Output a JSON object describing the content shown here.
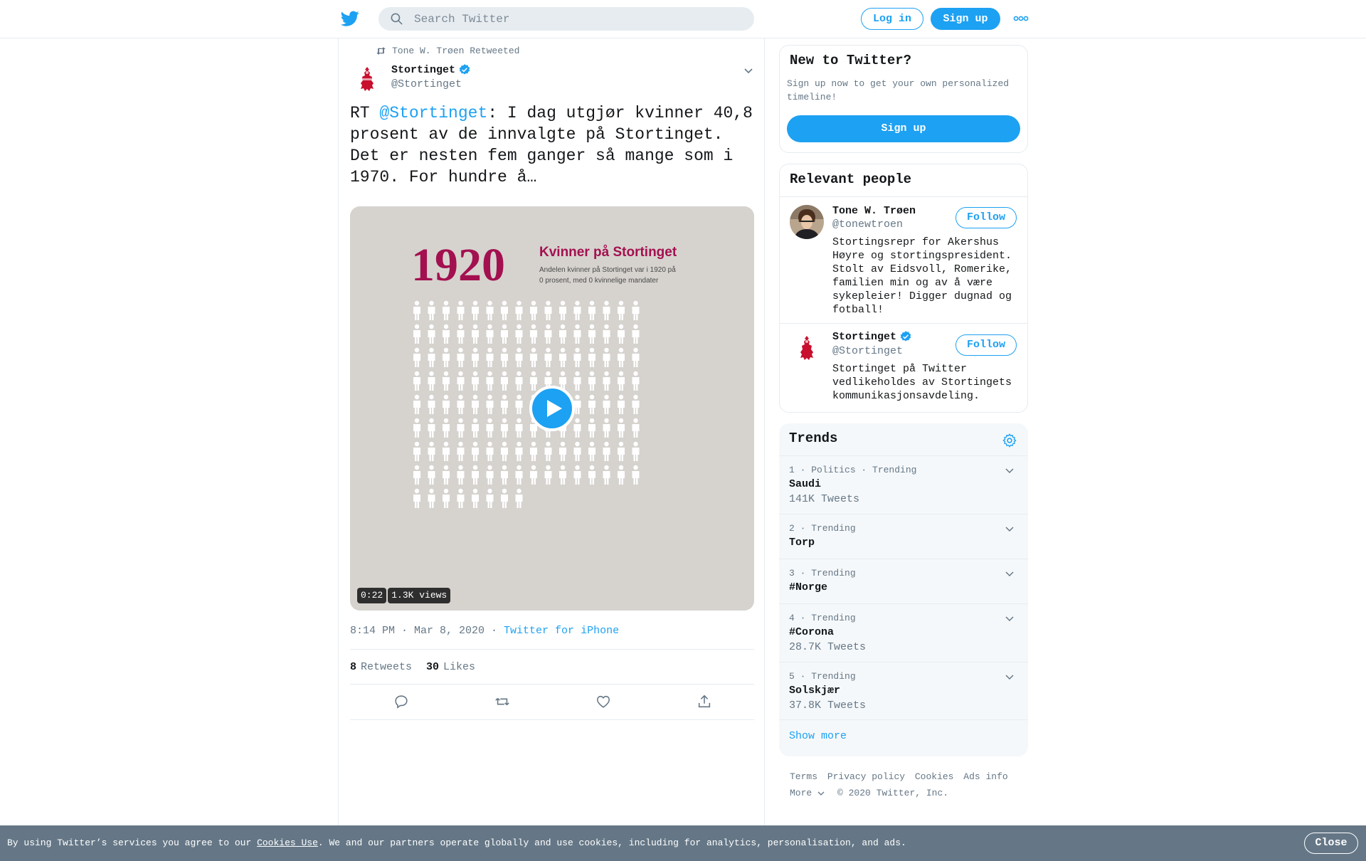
{
  "header": {
    "search_placeholder": "Search Twitter",
    "login_label": "Log in",
    "signup_label": "Sign up"
  },
  "tweet": {
    "retweeted_by": "Tone W. Trøen Retweeted",
    "author_name": "Stortinget",
    "author_handle": "@Stortinget",
    "text_prefix": "RT ",
    "text_mention": "@Stortinget",
    "text_body": ": I dag utgjør kvinner 40,8 prosent av de innvalgte på Stortinget. Det er nesten fem ganger så mange som i 1970. For hundre å…",
    "media": {
      "year": "1920",
      "headline": "Kvinner på Stortinget",
      "caption_line1": "Andelen kvinner på Stortinget var i 1920 på",
      "caption_line2": "0 prosent, med 0 kvinnelige mandater",
      "duration": "0:22",
      "views": "1.3K views"
    },
    "timestamp": "8:14 PM · Mar 8, 2020",
    "separator": " · ",
    "source": "Twitter for iPhone",
    "retweets_count": "8",
    "retweets_label": "Retweets",
    "likes_count": "30",
    "likes_label": "Likes"
  },
  "new_to_twitter": {
    "title": "New to Twitter?",
    "description": "Sign up now to get your own personalized timeline!",
    "signup_label": "Sign up"
  },
  "relevant_people": {
    "title": "Relevant people",
    "people": [
      {
        "name": "Tone W. Trøen",
        "handle": "@tonewtroen",
        "bio": "Stortingsrepr for Akershus Høyre og stortingspresident. Stolt av Eidsvoll, Romerike, familien min og av å være sykepleier! Digger dugnad og fotball!",
        "follow_label": "Follow"
      },
      {
        "name": "Stortinget",
        "handle": "@Stortinget",
        "bio": "Stortinget på Twitter vedlikeholdes av Stortingets kommunikasjonsavdeling.",
        "follow_label": "Follow"
      }
    ]
  },
  "trends": {
    "title": "Trends",
    "items": [
      {
        "meta": "1 · Politics · Trending",
        "name": "Saudi",
        "count": "141K Tweets"
      },
      {
        "meta": "2 · Trending",
        "name": "Torp",
        "count": ""
      },
      {
        "meta": "3 · Trending",
        "name": "#Norge",
        "count": ""
      },
      {
        "meta": "4 · Trending",
        "name": "#Corona",
        "count": "28.7K Tweets"
      },
      {
        "meta": "5 · Trending",
        "name": "Solskjær",
        "count": "37.8K Tweets"
      }
    ],
    "show_more": "Show more"
  },
  "footer": {
    "links": [
      "Terms",
      "Privacy policy",
      "Cookies",
      "Ads info"
    ],
    "more_label": "More",
    "copyright": "© 2020 Twitter, Inc."
  },
  "cookie_bar": {
    "text_before": "By using Twitter’s services you agree to our ",
    "link_label": "Cookies Use",
    "text_after": ". We and our partners operate globally and use cookies, including for analytics, personalisation, and ads.",
    "close_label": "Close"
  },
  "colors": {
    "brand_blue": "#1da1f2",
    "text_primary": "#14171a",
    "text_secondary": "#657786",
    "divider": "#e6ecf0",
    "media_accent": "#a3104f",
    "cookie_bar_bg": "#657786"
  },
  "icons": {
    "logo": "twitter-bird-icon",
    "search": "search-icon",
    "more": "more-dots-icon",
    "retweet": "retweet-icon",
    "verified": "verified-badge-icon",
    "reply": "reply-icon",
    "like": "heart-icon",
    "share": "share-icon",
    "settings": "gear-icon",
    "play": "play-icon"
  }
}
